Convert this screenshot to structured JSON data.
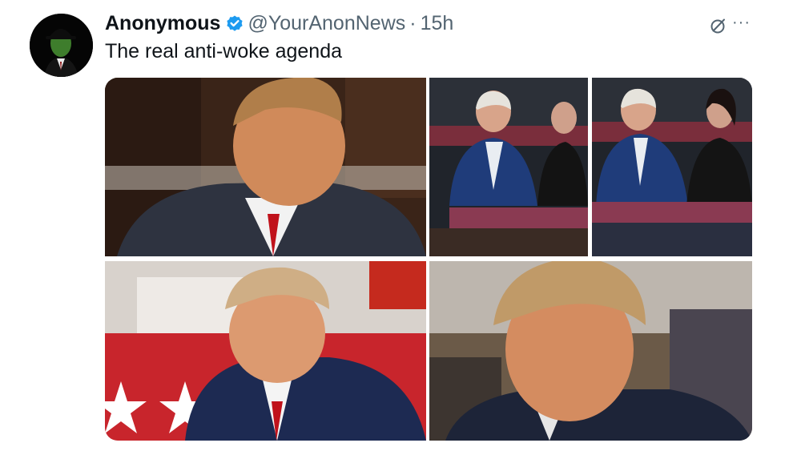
{
  "tweet": {
    "author_name": "Anonymous",
    "handle": "@YourAnonNews",
    "separator": "·",
    "time": "15h",
    "text": "The real anti-woke agenda",
    "more_label": "···",
    "verified_icon": "verified-badge-icon",
    "grok_icon": "grok-icon"
  },
  "colors": {
    "verified": "#1d9bf0",
    "text_primary": "#0f1419",
    "text_secondary": "#536471"
  },
  "media": {
    "count": 5
  }
}
